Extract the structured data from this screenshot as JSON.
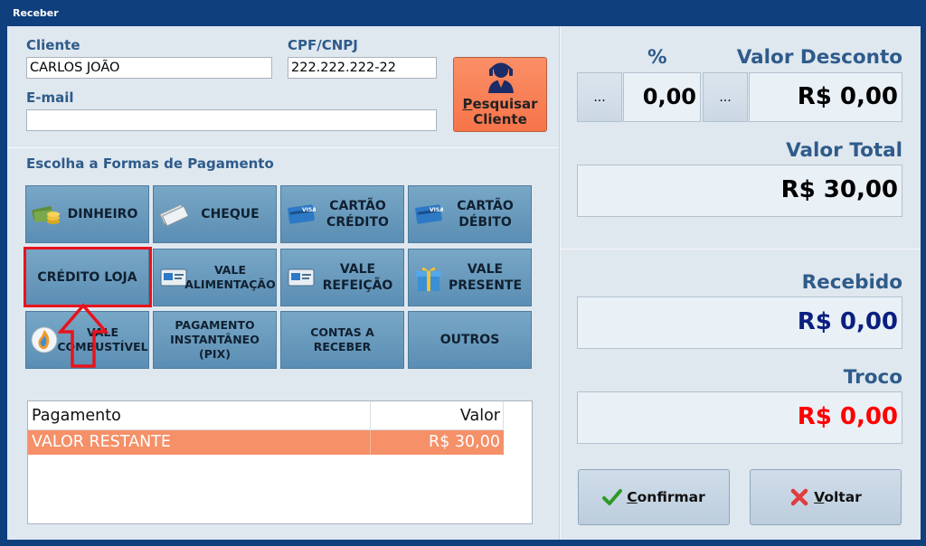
{
  "window": {
    "title": "Receber"
  },
  "cliente": {
    "label": "Cliente",
    "value": "CARLOS JOÃO"
  },
  "cpf": {
    "label": "CPF/CNPJ",
    "value": "222.222.222-22"
  },
  "email": {
    "label": "E-mail",
    "value": ""
  },
  "search_button": {
    "line1_first": "P",
    "line1_rest": "esquisar",
    "line2": "Cliente"
  },
  "payment": {
    "heading": "Escolha a Formas de Pagamento",
    "buttons": [
      {
        "line1": "DINHEIRO",
        "line2": "",
        "icon": "money-icon"
      },
      {
        "line1": "CHEQUE",
        "line2": "",
        "icon": "check-icon"
      },
      {
        "line1": "CARTÃO",
        "line2": "CRÉDITO",
        "icon": "credit-card-icon"
      },
      {
        "line1": "CARTÃO",
        "line2": "DÉBITO",
        "icon": "debit-card-icon"
      },
      {
        "line1": "CRÉDITO LOJA",
        "line2": "",
        "icon": ""
      },
      {
        "line1": "VALE",
        "line2": "ALIMENTAÇÃO",
        "icon": "meal-card-icon"
      },
      {
        "line1": "VALE",
        "line2": "REFEIÇÃO",
        "icon": "food-card-icon"
      },
      {
        "line1": "VALE",
        "line2": "PRESENTE",
        "icon": "gift-icon"
      },
      {
        "line1": "VALE",
        "line2": "COMBUSTÍVEL",
        "icon": "fuel-icon"
      },
      {
        "line1": "PAGAMENTO",
        "line2": "INSTANTÂNEO (PIX)",
        "icon": ""
      },
      {
        "line1": "CONTAS A RECEBER",
        "line2": "",
        "icon": ""
      },
      {
        "line1": "OUTROS",
        "line2": "",
        "icon": ""
      }
    ]
  },
  "grid": {
    "columns": [
      "Pagamento",
      "Valor"
    ],
    "rows": [
      {
        "pagamento": "VALOR RESTANTE",
        "valor": "R$ 30,00"
      }
    ]
  },
  "discount": {
    "percent_label": "%",
    "percent_value": "0,00",
    "value_label": "Valor Desconto",
    "value": "R$ 0,00",
    "dots": "..."
  },
  "total": {
    "label": "Valor Total",
    "value": "R$ 30,00"
  },
  "received": {
    "label": "Recebido",
    "value": "R$ 0,00"
  },
  "change": {
    "label": "Troco",
    "value": "R$ 0,00"
  },
  "actions": {
    "confirm_first": "C",
    "confirm_rest": "onfirmar",
    "back_first": "V",
    "back_rest": "oltar"
  },
  "colors": {
    "label": "#2e5b8a",
    "received_value": "#0a1f80",
    "change_value": "#ff0000",
    "highlight": "#e8131c",
    "grid_row": "#f59068"
  }
}
